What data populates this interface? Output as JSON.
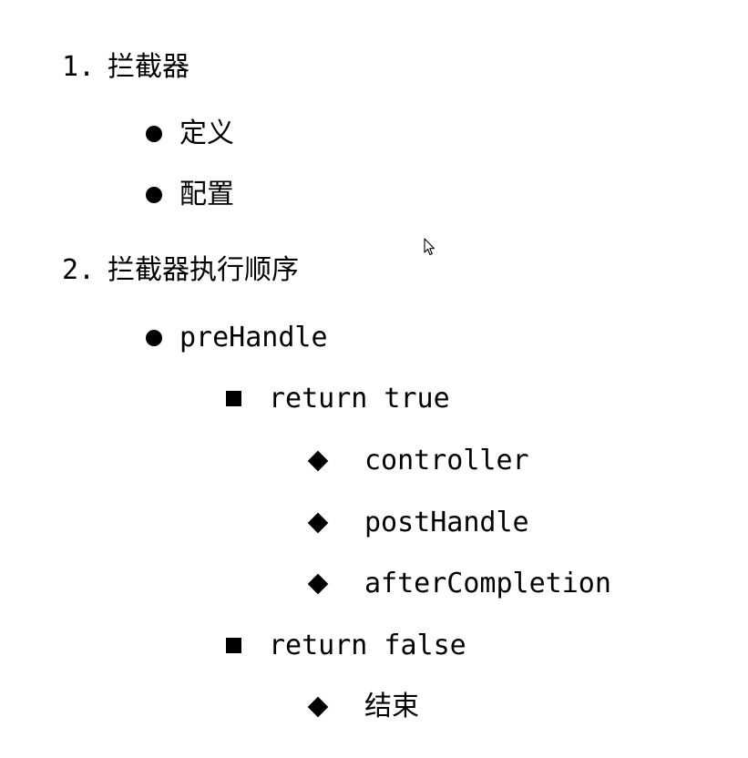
{
  "outline": {
    "section1": {
      "number": "1.",
      "title": "拦截器",
      "items": [
        "定义",
        "配置"
      ]
    },
    "section2": {
      "number": "2.",
      "title": "拦截器执行顺序",
      "method": "preHandle",
      "return_true": {
        "label": "return true",
        "steps": [
          "controller",
          "postHandle",
          "afterCompletion"
        ]
      },
      "return_false": {
        "label": "return false",
        "steps": [
          "结束"
        ]
      }
    }
  },
  "icons": {
    "level1_bullet": "filled-circle",
    "level2_bullet": "filled-square",
    "level3_bullet": "filled-diamond",
    "cursor": "mouse-pointer-icon"
  }
}
